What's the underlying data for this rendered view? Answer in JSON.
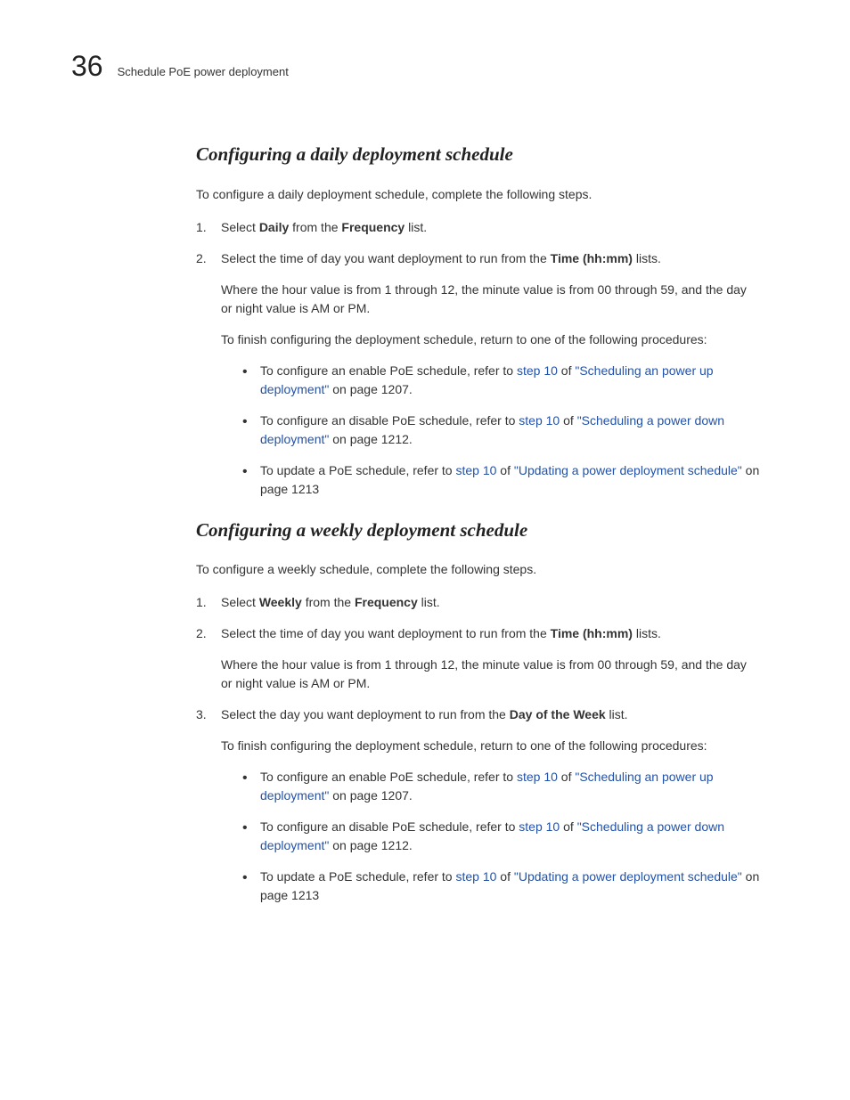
{
  "header": {
    "chapter_number": "36",
    "header_text": "Schedule PoE power deployment"
  },
  "sections": [
    {
      "heading": "Configuring a daily deployment schedule",
      "intro": "To configure a daily deployment schedule, complete the following steps.",
      "steps": [
        {
          "parts": [
            {
              "t": "text",
              "v": "Select "
            },
            {
              "t": "bold",
              "v": "Daily"
            },
            {
              "t": "text",
              "v": " from the "
            },
            {
              "t": "bold",
              "v": "Frequency"
            },
            {
              "t": "text",
              "v": " list."
            }
          ]
        },
        {
          "parts": [
            {
              "t": "text",
              "v": "Select the time of day you want deployment to run from the "
            },
            {
              "t": "bold",
              "v": "Time (hh:mm)"
            },
            {
              "t": "text",
              "v": " lists."
            }
          ],
          "sub": [
            "Where the hour value is from 1 through 12, the minute value is from 00 through 59, and the day or night value is AM or PM.",
            "To finish configuring the deployment schedule, return to one of the following procedures:"
          ],
          "bullets": [
            {
              "parts": [
                {
                  "t": "text",
                  "v": "To configure an enable PoE schedule, refer to "
                },
                {
                  "t": "link",
                  "v": "step 10"
                },
                {
                  "t": "text",
                  "v": " of "
                },
                {
                  "t": "qlink",
                  "v": "\"Scheduling an power up deployment\""
                },
                {
                  "t": "text",
                  "v": " on page 1207."
                }
              ]
            },
            {
              "parts": [
                {
                  "t": "text",
                  "v": "To configure an disable PoE schedule, refer to "
                },
                {
                  "t": "link",
                  "v": "step 10"
                },
                {
                  "t": "text",
                  "v": " of "
                },
                {
                  "t": "qlink",
                  "v": "\"Scheduling a power down deployment\""
                },
                {
                  "t": "text",
                  "v": " on page 1212."
                }
              ]
            },
            {
              "parts": [
                {
                  "t": "text",
                  "v": "To update a PoE schedule, refer to "
                },
                {
                  "t": "link",
                  "v": "step 10"
                },
                {
                  "t": "text",
                  "v": " of "
                },
                {
                  "t": "qlink",
                  "v": "\"Updating a power deployment schedule\""
                },
                {
                  "t": "text",
                  "v": " on page 1213"
                }
              ]
            }
          ]
        }
      ]
    },
    {
      "heading": "Configuring a weekly deployment schedule",
      "intro": "To configure a weekly schedule, complete the following steps.",
      "steps": [
        {
          "parts": [
            {
              "t": "text",
              "v": "Select "
            },
            {
              "t": "bold",
              "v": "Weekly"
            },
            {
              "t": "text",
              "v": " from the "
            },
            {
              "t": "bold",
              "v": "Frequency"
            },
            {
              "t": "text",
              "v": " list."
            }
          ]
        },
        {
          "parts": [
            {
              "t": "text",
              "v": "Select the time of day you want deployment to run from the "
            },
            {
              "t": "bold",
              "v": "Time (hh:mm)"
            },
            {
              "t": "text",
              "v": " lists."
            }
          ],
          "sub": [
            "Where the hour value is from 1 through 12, the minute value is from 00 through 59, and the day or night value is AM or PM."
          ]
        },
        {
          "parts": [
            {
              "t": "text",
              "v": "Select the day you want deployment to run from the "
            },
            {
              "t": "bold",
              "v": "Day of the Week"
            },
            {
              "t": "text",
              "v": " list."
            }
          ],
          "sub": [
            "To finish configuring the deployment schedule, return to one of the following procedures:"
          ],
          "bullets": [
            {
              "parts": [
                {
                  "t": "text",
                  "v": "To configure an enable PoE schedule, refer to "
                },
                {
                  "t": "link",
                  "v": "step 10"
                },
                {
                  "t": "text",
                  "v": " of "
                },
                {
                  "t": "qlink",
                  "v": "\"Scheduling an power up deployment\""
                },
                {
                  "t": "text",
                  "v": " on page 1207."
                }
              ]
            },
            {
              "parts": [
                {
                  "t": "text",
                  "v": "To configure an disable PoE schedule, refer to "
                },
                {
                  "t": "link",
                  "v": "step 10"
                },
                {
                  "t": "text",
                  "v": " of "
                },
                {
                  "t": "qlink",
                  "v": "\"Scheduling a power down deployment\""
                },
                {
                  "t": "text",
                  "v": " on page 1212."
                }
              ]
            },
            {
              "parts": [
                {
                  "t": "text",
                  "v": "To update a PoE schedule, refer to "
                },
                {
                  "t": "link",
                  "v": "step 10"
                },
                {
                  "t": "text",
                  "v": " of "
                },
                {
                  "t": "qlink",
                  "v": "\"Updating a power deployment schedule\""
                },
                {
                  "t": "text",
                  "v": " on page 1213"
                }
              ]
            }
          ]
        }
      ]
    }
  ]
}
